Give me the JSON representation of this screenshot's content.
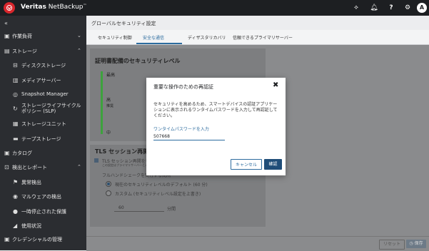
{
  "topbar": {
    "brand_prefix": "Veritas",
    "brand_suffix": " NetBackup",
    "brand_tm": "™",
    "icons": [
      "activity-icon",
      "bell-icon",
      "help-icon",
      "gear-icon"
    ],
    "avatar_letter": "A"
  },
  "sidebar": {
    "collapse_icon": "«",
    "items": [
      {
        "icon": "briefcase-icon",
        "label": "作業負荷",
        "chevron": "⌄"
      },
      {
        "icon": "storage-icon",
        "label": "ストレージ",
        "chevron": "⌃"
      },
      {
        "icon": "disk-icon",
        "label": "ディスクストレージ"
      },
      {
        "icon": "media-server-icon",
        "label": "メディアサーバー"
      },
      {
        "icon": "snapshot-icon",
        "label": "Snapshot Manager"
      },
      {
        "icon": "lifecycle-icon",
        "label_line1": "ストレージライフサイクル",
        "label_line2": "ポリシー (SLP)"
      },
      {
        "icon": "storage-unit-icon",
        "label": "ストレージユニット"
      },
      {
        "icon": "tape-icon",
        "label": "テープストレージ"
      },
      {
        "icon": "catalog-icon",
        "label": "カタログ"
      },
      {
        "icon": "report-icon",
        "label": "検出とレポート",
        "chevron": "⌃"
      },
      {
        "icon": "flag-icon",
        "label": "異常検出"
      },
      {
        "icon": "malware-icon",
        "label": "マルウェアの検出"
      },
      {
        "icon": "pause-icon",
        "label": "一時停止された保護"
      },
      {
        "icon": "chart-icon",
        "label": "使用状況"
      },
      {
        "icon": "credential-icon",
        "label": "クレデンシャルの管理"
      }
    ]
  },
  "main": {
    "title": "グローバルセキュリティ設定",
    "tabs": [
      "セキュリティ制御",
      "安全な通信",
      "ディザスタリカバリ",
      "信頼できるプライマリサーバー"
    ],
    "cert_card": {
      "title": "証明書配備のセキュリティレベル",
      "levels": {
        "high": "最高",
        "mid": "高",
        "mid_sub": "推奨",
        "low": "中"
      }
    },
    "tls_card": {
      "title": "TLS セッション再開",
      "checkbox_label": "TLS セッション再開を有効化する",
      "checkbox_sub": "この設定はプライマリサーバーとメディアサーバーに適用されます。",
      "handshake_label": "フルハンドシェークを実行する間隔",
      "opt_default": "現在のセキュリティレベルのデフォルト (60 分)",
      "opt_custom": "カスタム (セキュリティレベル設定を上書き)",
      "custom_value": "60",
      "unit": "分間"
    },
    "footer": {
      "reset": "リセット",
      "save": "保存"
    }
  },
  "modal": {
    "title": "重要な操作のための再認証",
    "close": "✖",
    "description": "セキュリティを高めるため、スマートデバイスの認証アプリケーションに表示されるワンタイムパスワードを入力して再認証してください。",
    "otp_label": "ワンタイムパスワードを入力",
    "otp_value": "507668",
    "cancel": "キャンセル",
    "confirm": "確認"
  }
}
